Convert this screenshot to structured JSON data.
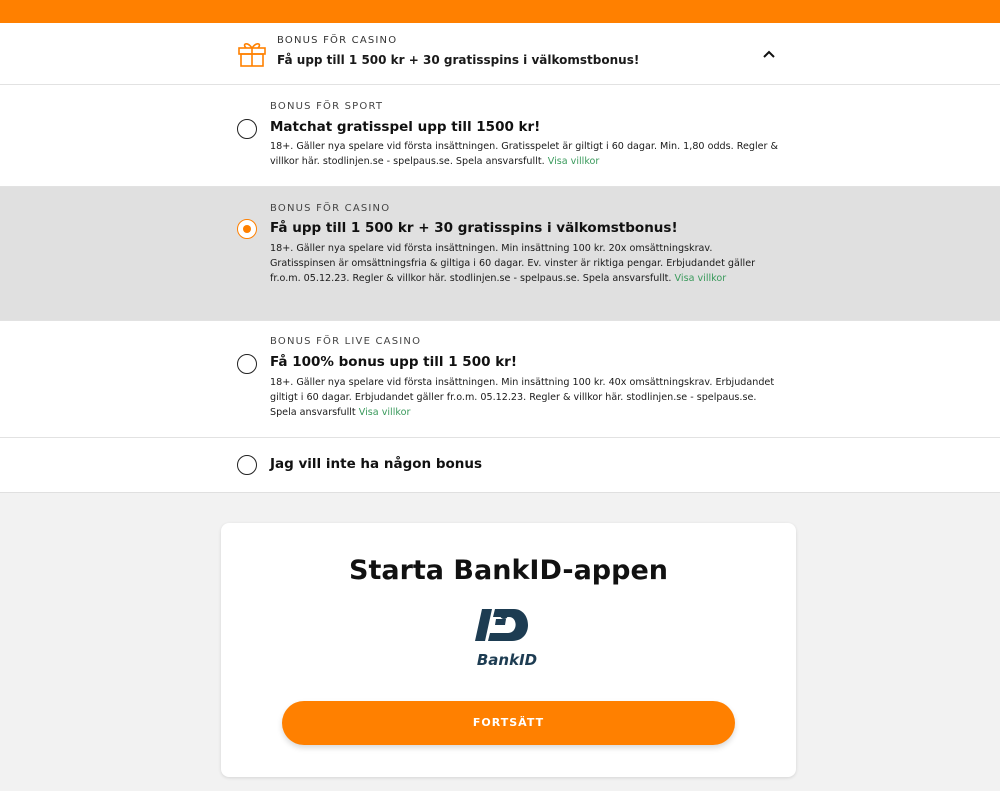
{
  "header": {
    "category": "BONUS FÖR CASINO",
    "title": "Få upp till 1 500 kr + 30 gratisspins i välkomstbonus!"
  },
  "options": [
    {
      "category": "BONUS FÖR SPORT",
      "title": "Matchat gratisspel upp till 1500 kr!",
      "terms": "18+. Gäller nya spelare vid första insättningen. Gratisspelet är giltigt i 60 dagar. Min. 1,80 odds. Regler & villkor här. stodlinjen.se - spelpaus.se. Spela ansvarsfullt.",
      "link": "Visa villkor",
      "selected": false
    },
    {
      "category": "BONUS FÖR CASINO",
      "title": "Få upp till 1 500 kr + 30 gratisspins i välkomstbonus!",
      "terms": "18+. Gäller nya spelare vid första insättningen. Min insättning 100 kr. 20x omsättningskrav. Gratisspinsen är omsättningsfria & giltiga i 60 dagar. Ev. vinster är riktiga pengar. Erbjudandet gäller fr.o.m. 05.12.23. Regler & villkor här. stodlinjen.se - spelpaus.se. Spela ansvarsfullt.",
      "link": "Visa villkor",
      "selected": true
    },
    {
      "category": "BONUS FÖR LIVE CASINO",
      "title": "Få 100% bonus upp till 1 500 kr!",
      "terms": "18+. Gäller nya spelare vid första insättningen. Min insättning 100 kr. 40x omsättningskrav. Erbjudandet giltigt i 60 dagar. Erbjudandet gäller fr.o.m. 05.12.23. Regler & villkor här. stodlinjen.se - spelpaus.se. Spela ansvarsfullt",
      "link": "Visa villkor",
      "selected": false
    }
  ],
  "no_bonus": {
    "title": "Jag vill inte ha någon bonus"
  },
  "bankid": {
    "title": "Starta BankID-appen",
    "logo_text": "BankID",
    "button_label": "FORTSÄTT"
  },
  "colors": {
    "accent": "#ff8000",
    "link": "#3a9a5c",
    "selected_bg": "#e0e0e0",
    "logo": "#1d3c52"
  },
  "icons": {
    "header": "gift-icon",
    "toggle": "chevron-up-icon",
    "logo": "bankid-logo"
  }
}
